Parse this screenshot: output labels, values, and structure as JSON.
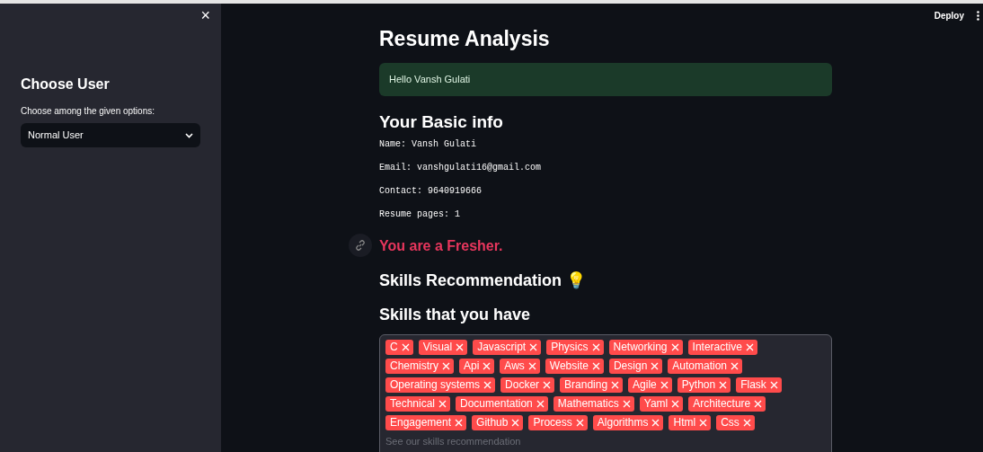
{
  "sidebar": {
    "close": "×",
    "title": "Choose User",
    "select_label": "Choose among the given options:",
    "select_value": "Normal User"
  },
  "header": {
    "deploy": "Deploy"
  },
  "title": "Resume Analysis",
  "greeting": "Hello Vansh Gulati",
  "basic_info_heading": "Your Basic info",
  "basic_info": [
    "Name: Vansh Gulati",
    "Email: vanshgulati16@gmail.com",
    "Contact: 9640919666",
    "Resume pages: 1"
  ],
  "level_message": "You are a Fresher.",
  "skills_recommendation_heading": "Skills Recommendation 💡",
  "skills_heading": "Skills that you have",
  "skills": [
    "C",
    "Visual",
    "Javascript",
    "Physics",
    "Networking",
    "Interactive",
    "Chemistry",
    "Api",
    "Aws",
    "Website",
    "Design",
    "Automation",
    "Operating systems",
    "Docker",
    "Branding",
    "Agile",
    "Python",
    "Flask",
    "Technical",
    "Documentation",
    "Mathematics",
    "Yaml",
    "Architecture",
    "Engagement",
    "Github",
    "Process",
    "Algorithms",
    "Html",
    "Css"
  ],
  "skills_placeholder": "See our skills recommendation"
}
